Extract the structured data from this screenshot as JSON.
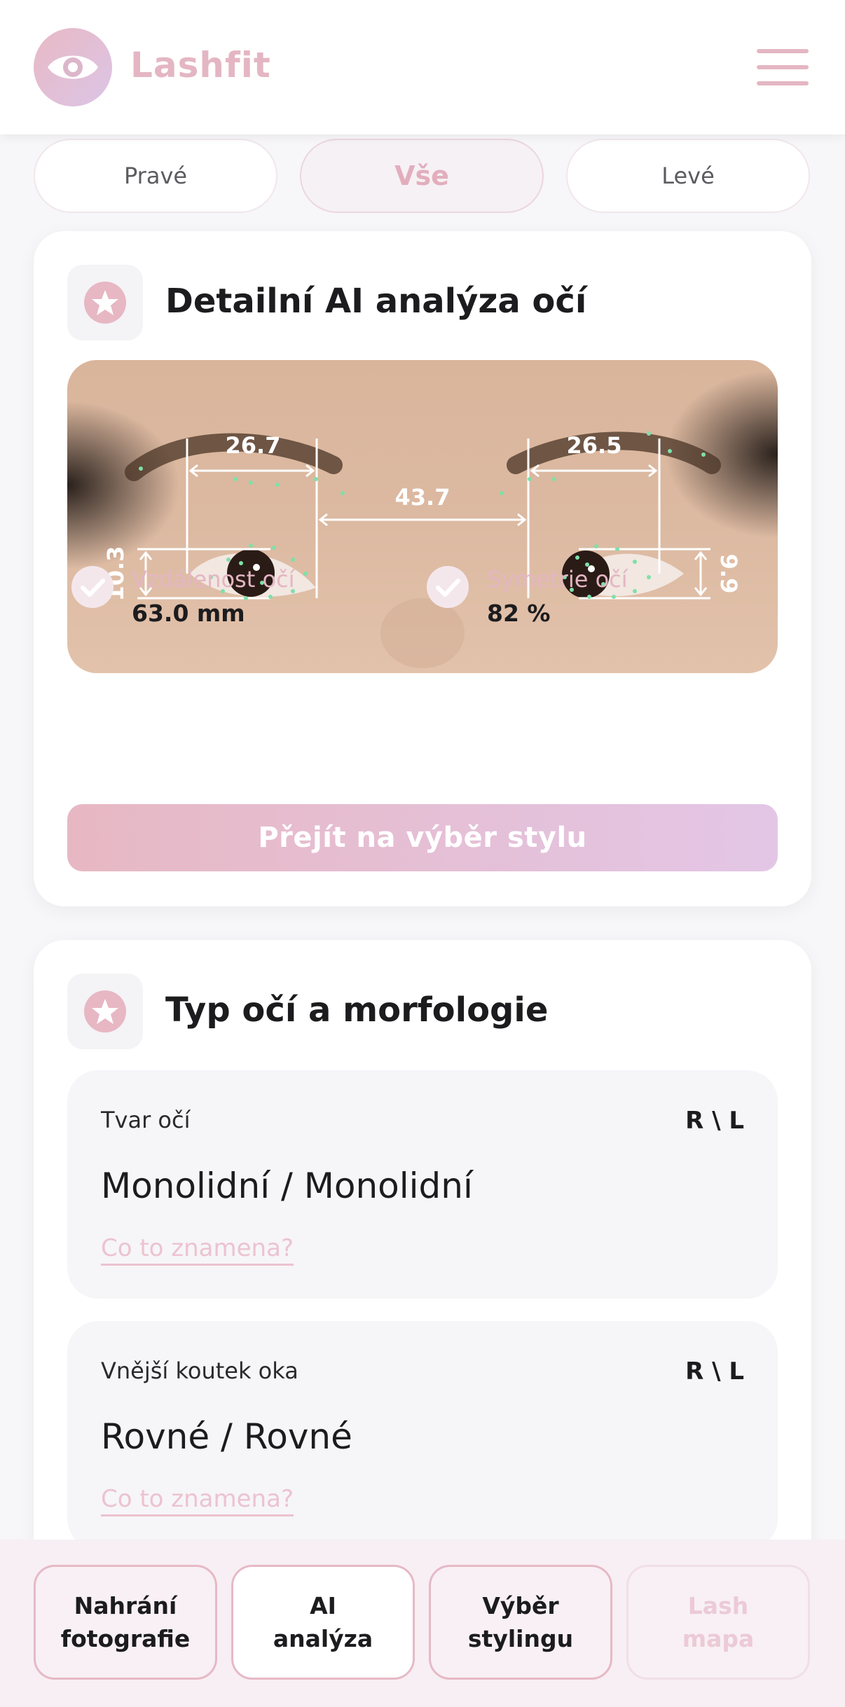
{
  "header": {
    "brand": "Lashfit"
  },
  "segments": [
    "Pravé",
    "Vše",
    "Levé"
  ],
  "analysis_card": {
    "title": "Detailní AI analýza očí",
    "measurements": {
      "left_eye_width": "26.7",
      "right_eye_width": "26.5",
      "inner_distance": "43.7",
      "left_eye_height": "10.3",
      "right_eye_height": "9.9"
    },
    "metrics": [
      {
        "label": "Vzdálenost očí",
        "value": "63.0 mm"
      },
      {
        "label": "Symetrie očí",
        "value": "82 %"
      }
    ],
    "cta": "Přejít na výběr stylu"
  },
  "morphology_card": {
    "title": "Typ očí a morfologie",
    "items": [
      {
        "label": "Tvar očí",
        "side": "R \\ L",
        "value": "Monolidní / Monolidní",
        "link": "Co to znamena?"
      },
      {
        "label": "Vnější koutek oka",
        "side": "R \\ L",
        "value": "Rovné / Rovné",
        "link": "Co to znamena?"
      }
    ]
  },
  "bottom_nav": [
    {
      "line1": "Nahrání",
      "line2": "fotografie"
    },
    {
      "line1": "AI",
      "line2": "analýza"
    },
    {
      "line1": "Výběr",
      "line2": "stylingu"
    },
    {
      "line1": "Lash",
      "line2": "mapa"
    }
  ],
  "colors": {
    "accent": "#e4b6c3",
    "landmark": "#7fe0a8",
    "background": "#f7f6f8"
  }
}
